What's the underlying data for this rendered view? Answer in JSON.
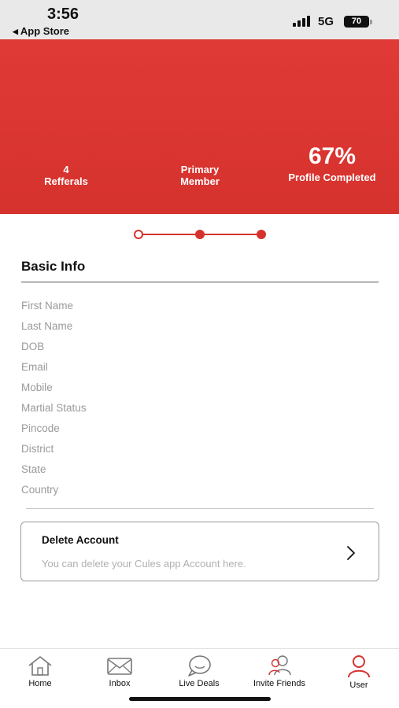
{
  "status_bar": {
    "time": "3:56",
    "back_app": "App Store",
    "network": "5G",
    "battery": "70"
  },
  "profile_header": {
    "referrals_count": "4",
    "referrals_label": "Refferals",
    "membership_line1": "Primary",
    "membership_line2": "Member",
    "completion_value": "67%",
    "completion_label": "Profile Completed",
    "completion_fraction": 0.67,
    "background_color": "#d6322d"
  },
  "stepper": {
    "steps_total": 3,
    "current_step": 1
  },
  "basic_info": {
    "title": "Basic Info",
    "fields": [
      "First Name",
      "Last Name",
      "DOB",
      "Email",
      "Mobile",
      "Martial Status",
      "Pincode",
      "District",
      "State",
      "Country"
    ]
  },
  "delete_account": {
    "title": "Delete Account",
    "subtitle": "You can delete your Cules app Account here.",
    "icon": "chevron-right-icon"
  },
  "tab_bar": {
    "active_color": "#d6322d",
    "tabs": [
      {
        "label": "Home",
        "icon": "home-icon",
        "active": false
      },
      {
        "label": "Inbox",
        "icon": "envelope-icon",
        "active": false
      },
      {
        "label": "Live Deals",
        "icon": "chat-bubble-icon",
        "active": false
      },
      {
        "label": "Invite Friends",
        "icon": "users-icon",
        "active": false
      },
      {
        "label": "User",
        "icon": "user-icon",
        "active": true
      }
    ]
  }
}
